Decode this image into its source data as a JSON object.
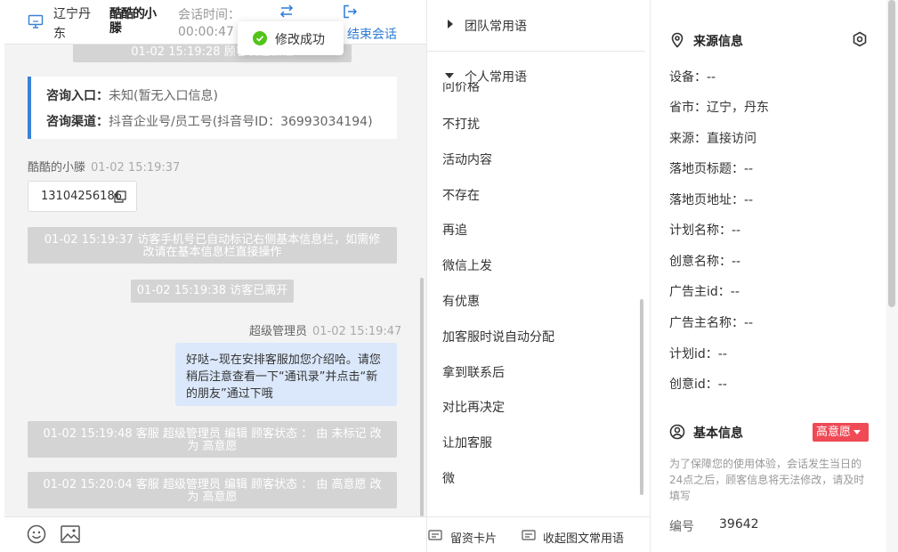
{
  "header": {
    "location": "辽宁丹东",
    "visitor_name": "酷酷的小滕",
    "time_label": "会话时间：",
    "duration": "00:00:47",
    "end_session_label": "结束会话",
    "transfer_icon": "transfer-icon",
    "exit_icon": "exit-icon",
    "monitor_icon": "monitor-icon"
  },
  "toast": {
    "text": "修改成功",
    "icon": "check-circle-icon",
    "color": "#52c41a"
  },
  "chat": {
    "top_system_partial": "01-02 15:19:28 顾客发起会话",
    "entry": {
      "entry_label": "咨询入口：",
      "entry_value": "未知(暂无入口信息)",
      "channel_label": "咨询渠道：",
      "channel_value": "抖音企业号/员工号(抖音号ID：36993034194)"
    },
    "visitor_msg": {
      "sender": "酷酷的小滕",
      "time": "01-02 15:19:37",
      "phone": "13104256186"
    },
    "system_phone_tag": "01-02 15:19:37 访客手机号已自动标记右侧基本信息栏，如需修改请在基本信息栏直接操作",
    "system_left": "01-02 15:19:38 访客已离开",
    "agent_msg": {
      "sender": "超级管理员",
      "time": "01-02 15:19:47",
      "text": "好哒~现在安排客服加您介绍哈。请您稍后注意查看一下“通讯录”并点击“新的朋友”通过下哦"
    },
    "system_edit_1": "01-02 15:19:48 客服 超级管理员 编辑 顾客状态 ： 由 未标记 改为 高意愿",
    "system_edit_2": "01-02 15:20:04 客服 超级管理员 编辑 顾客状态 ： 由 高意愿 改为 高意愿",
    "footer_icons": [
      "emoji-icon",
      "image-icon"
    ]
  },
  "phrases": {
    "team_group": "团队常用语",
    "personal_group": "个人常用语",
    "partial_item": "问价格",
    "items": [
      "不打扰",
      "活动内容",
      "不存在",
      "再追",
      "微信上发",
      "有优惠",
      "加客服时说自动分配",
      "拿到联系后",
      "对比再决定",
      "让加客服",
      "微"
    ],
    "footer": {
      "card_label": "留资卡片",
      "collapse_label": "收起图文常用语"
    }
  },
  "source_info": {
    "title": "来源信息",
    "fields": [
      "设备：--",
      "省市：辽宁，丹东",
      "来源：直接访问",
      "落地页标题：--",
      "落地页地址：--",
      "计划名称：--",
      "创意名称：--",
      "广告主id：--",
      "广告主名称：--",
      "计划id：--",
      "创意id：--"
    ]
  },
  "basic_info": {
    "title": "基本信息",
    "intent_badge": "高意愿",
    "intent_color": "#ef4a55",
    "notice": "为了保障您的使用体验，会话发生当日的24点之后，顾客信息将无法修改，请及时填写",
    "id_label": "编号",
    "id_value": "39642"
  },
  "colors": {
    "accent": "#2d7cd6",
    "system_bubble": "#d4d4d4",
    "agent_bubble": "#dbe8fb"
  }
}
